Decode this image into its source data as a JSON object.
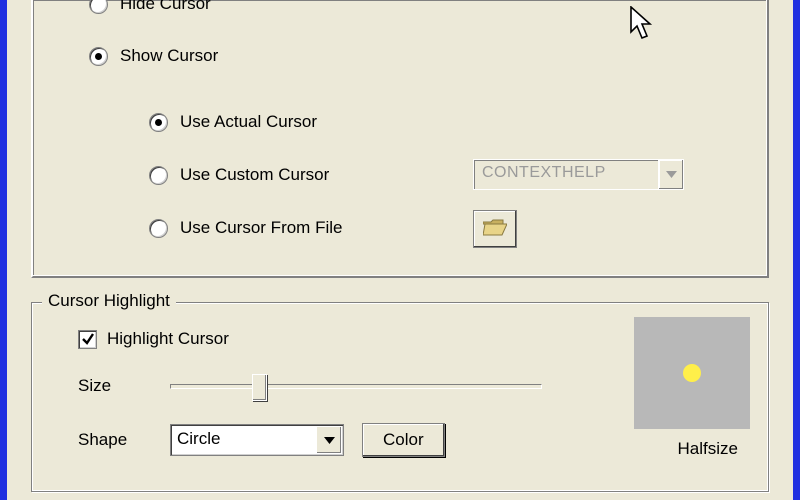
{
  "cursor_mode": {
    "hide_label": "Hide Cursor",
    "show_label": "Show Cursor",
    "selected": "show",
    "sub": {
      "actual_label": "Use Actual Cursor",
      "custom_label": "Use Custom Cursor",
      "file_label": "Use Cursor From File",
      "selected": "actual",
      "custom_combo_value": "CONTEXTHELP"
    }
  },
  "highlight": {
    "legend": "Cursor Highlight",
    "checkbox_label": "Highlight Cursor",
    "checked": true,
    "size_label": "Size",
    "shape_label": "Shape",
    "shape_value": "Circle",
    "color_button": "Color",
    "halfsize_label": "Halfsize",
    "preview_color": "#ffef4a"
  }
}
